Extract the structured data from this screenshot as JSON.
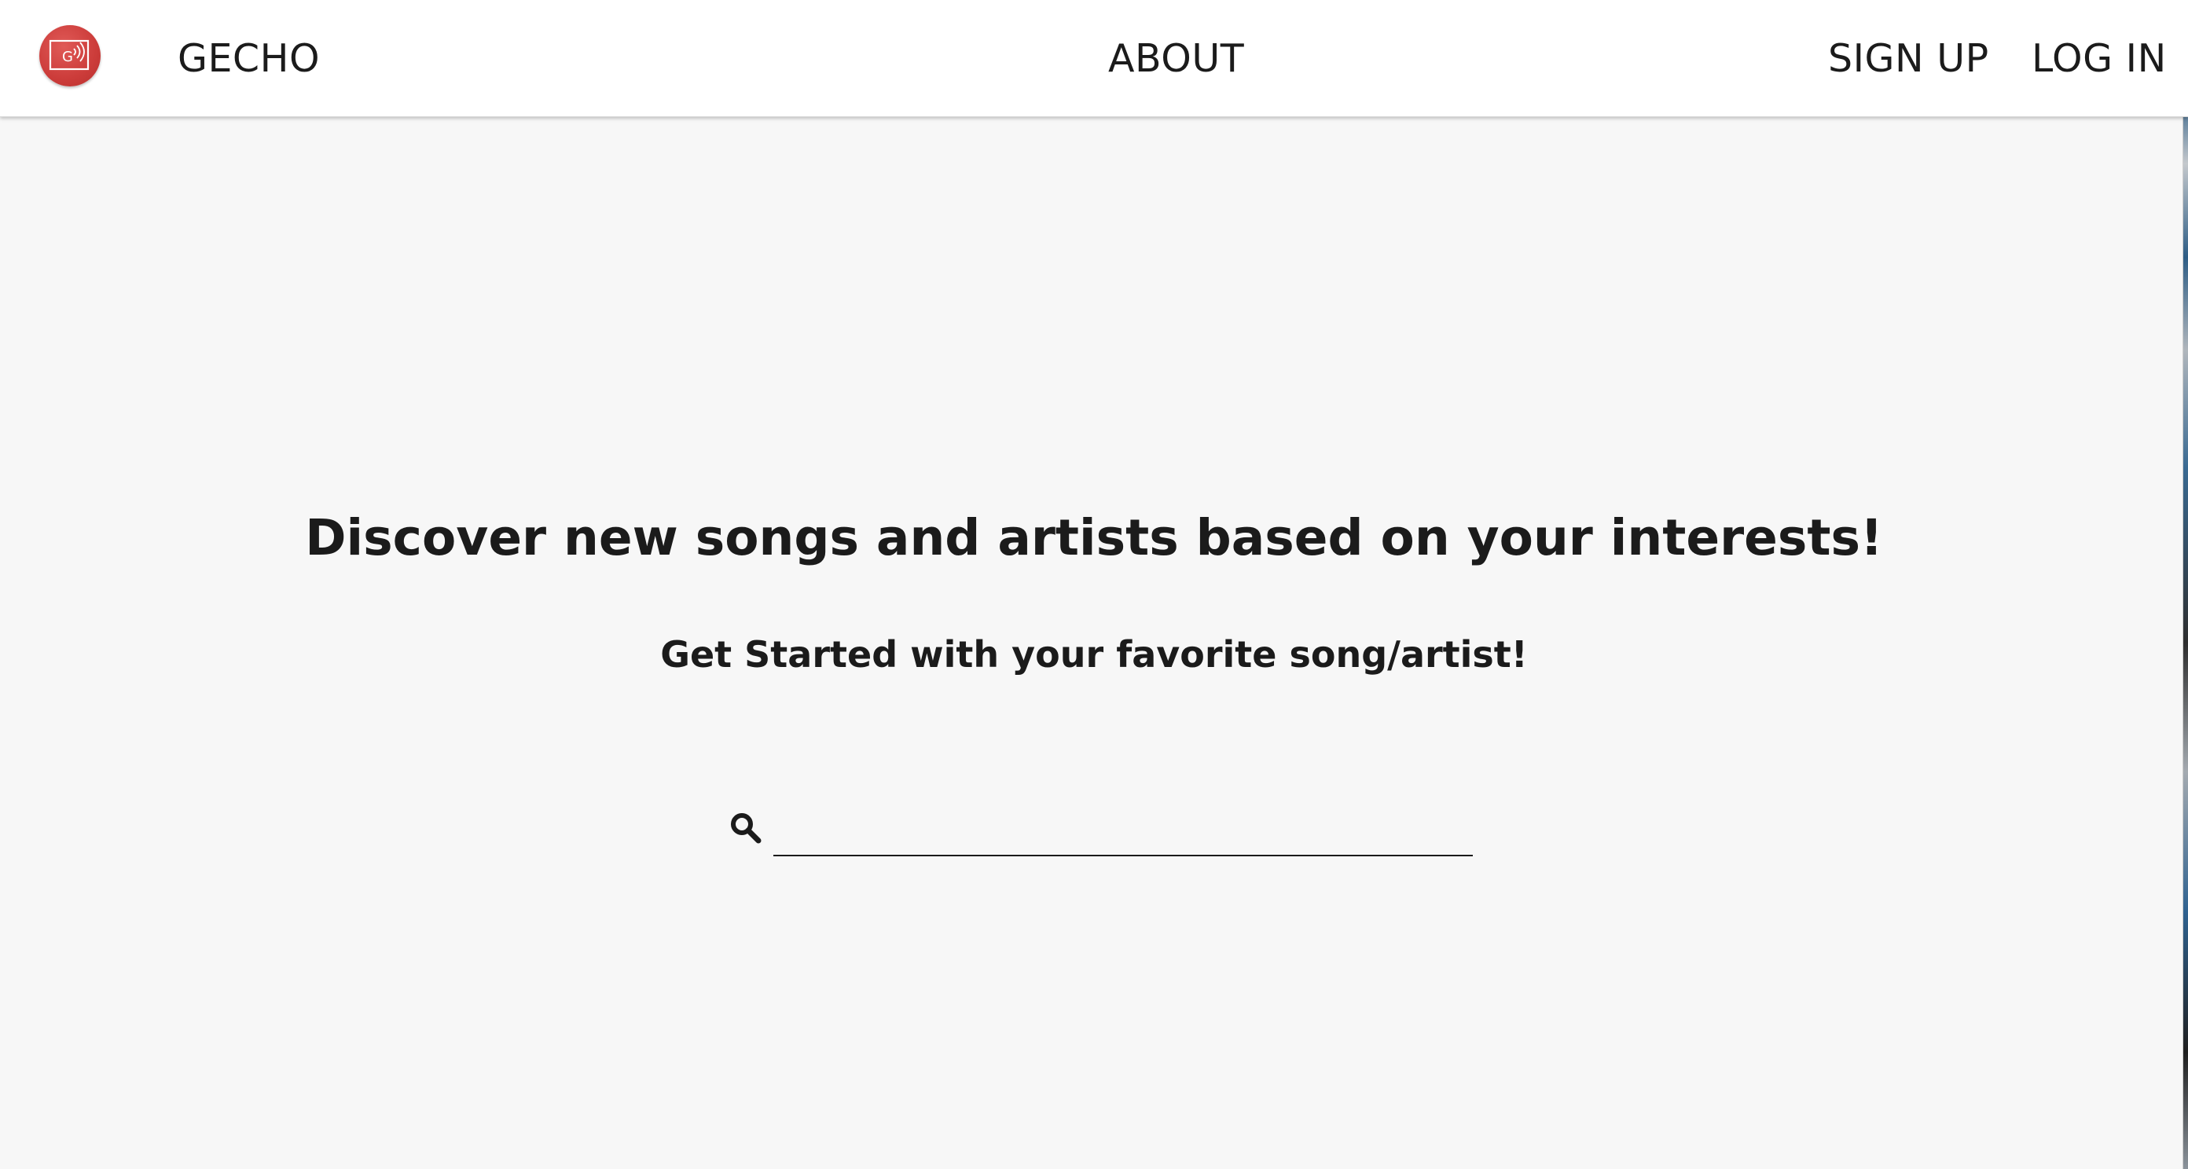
{
  "nav": {
    "brand": "GECHO",
    "logo_letter": "G",
    "about": "ABOUT",
    "signup": "SIGN UP",
    "login": "LOG IN"
  },
  "hero": {
    "headline": "Discover new songs and artists based on your interests!",
    "subhead": "Get Started with your favorite song/artist!"
  },
  "search": {
    "icon": "search-icon",
    "value": "",
    "placeholder": ""
  },
  "colors": {
    "accent": "#cc3c3a",
    "background": "#f7f7f7",
    "navbar": "#ffffff",
    "text": "#1b1b1b"
  }
}
